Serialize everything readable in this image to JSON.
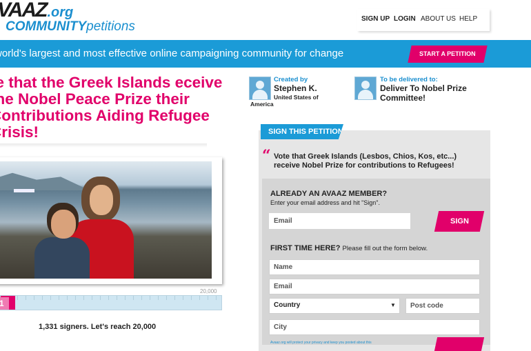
{
  "logo": {
    "line1": "VAAZ",
    "line1_suffix": ".org",
    "line2": "COMMUNITY",
    "line2_suffix": "petitions"
  },
  "nav": {
    "signup": "SIGN UP",
    "login": "LOGIN",
    "about": "ABOUT US",
    "help": "HELP"
  },
  "banner": {
    "text": "world's largest and most effective online campaigning community for change",
    "start_label": "START A PETITION"
  },
  "petition": {
    "title": "te that the Greek Islands eceive the Nobel Peace Prize their Contributions Aiding Refugee Crisis!",
    "progress_max": "20,000",
    "progress_count": "1",
    "progress_fraction": 0.066,
    "signers_text": "1,331 signers. Let's reach 20,000"
  },
  "creator": {
    "label": "Created by",
    "name": "Stephen K.",
    "location_line1": "United States of",
    "location_line2": "America"
  },
  "delivery": {
    "label": "To be delivered to:",
    "recipient": "Deliver To Nobel Prize Committee!"
  },
  "sign": {
    "tab_label": "SIGN THIS PETITION",
    "quote_mark": "“",
    "quote": "Vote that Greek Islands (Lesbos, Chios, Kos, etc...) receive Nobel Prize for contributions to Refugees!",
    "member_heading": "ALREADY AN AVAAZ MEMBER?",
    "member_sub": "Enter your email address and hit \"Sign\".",
    "member_email_placeholder": "Email",
    "sign_button": "SIGN",
    "first_time_heading": "FIRST TIME HERE?",
    "first_time_sub": "Please fill out the form below.",
    "name_placeholder": "Name",
    "email_placeholder": "Email",
    "country_selected": "Country",
    "postcode_placeholder": "Post code",
    "city_placeholder": "City",
    "select_arrow": "▼",
    "fine_print": "Avaaz.org will protect your privacy and keep you posted about this"
  }
}
